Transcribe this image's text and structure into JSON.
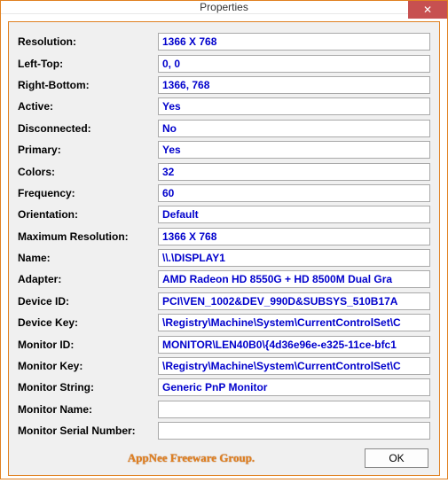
{
  "window": {
    "title": "Properties",
    "close_glyph": "✕"
  },
  "rows": [
    {
      "label": "Resolution:",
      "value": "1366 X 768"
    },
    {
      "label": "Left-Top:",
      "value": "0, 0"
    },
    {
      "label": "Right-Bottom:",
      "value": "1366, 768"
    },
    {
      "label": "Active:",
      "value": "Yes"
    },
    {
      "label": "Disconnected:",
      "value": "No"
    },
    {
      "label": "Primary:",
      "value": "Yes"
    },
    {
      "label": "Colors:",
      "value": "32"
    },
    {
      "label": "Frequency:",
      "value": "60"
    },
    {
      "label": "Orientation:",
      "value": "Default"
    },
    {
      "label": "Maximum Resolution:",
      "value": "1366 X 768"
    },
    {
      "label": "Name:",
      "value": "\\\\.\\DISPLAY1"
    },
    {
      "label": "Adapter:",
      "value": "AMD Radeon HD 8550G + HD 8500M Dual Gra"
    },
    {
      "label": "Device ID:",
      "value": "PCI\\VEN_1002&DEV_990D&SUBSYS_510B17A"
    },
    {
      "label": "Device Key:",
      "value": "\\Registry\\Machine\\System\\CurrentControlSet\\C"
    },
    {
      "label": "Monitor ID:",
      "value": "MONITOR\\LEN40B0\\{4d36e96e-e325-11ce-bfc1"
    },
    {
      "label": "Monitor Key:",
      "value": "\\Registry\\Machine\\System\\CurrentControlSet\\C"
    },
    {
      "label": "Monitor String:",
      "value": "Generic PnP Monitor"
    },
    {
      "label": "Monitor Name:",
      "value": ""
    },
    {
      "label": "Monitor Serial Number:",
      "value": ""
    }
  ],
  "footer": {
    "branding": "AppNee Freeware Group.",
    "ok_label": "OK"
  }
}
